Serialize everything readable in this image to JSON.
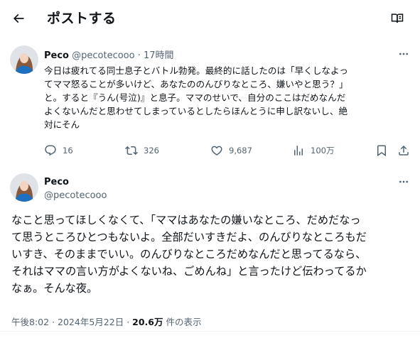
{
  "header": {
    "title": "ポストする",
    "back_icon": "arrow-left-icon",
    "reader_icon": "book-open-icon"
  },
  "parent_post": {
    "name": "Peco",
    "handle": "@pecotecooo",
    "separator": "·",
    "time": "17時間",
    "lines": [
      "今日は疲れてる同士息子とバトル勃発。最終的に話したのは「早くしなよっ",
      "てママ怒ることが多いけど、あなたののんびりなところ、嫌いやと思う？」",
      "と。すると『うん(号泣)』と息子。ママのせいで、自分のここはだめなんだ",
      "よくないんだと思わせてしまっているとしたらほんとうに申し訳ないし、絶",
      "対にそん"
    ],
    "actions": {
      "replies": "16",
      "reposts": "326",
      "likes": "9,687",
      "views": "100万"
    }
  },
  "main_post": {
    "name": "Peco",
    "handle": "@pecotecooo",
    "lines": [
      "なこと思ってほしくなくて、「ママはあなたの嫌いなところ、だめだなっ",
      "て思うところひとつもないよ。全部だいすきだよ、のんびりなところもだ",
      "いすき、そのままでいい。のんびりなところだめなんだと思ってるなら、",
      "それはママの言い方がよくないね、ごめんね」と言ったけど伝わってるか",
      "なぁ。そんな夜。"
    ],
    "time": "午後8:02",
    "separator": "·",
    "date": "2024年5月22日",
    "views_count": "20.6万",
    "views_label": "件の表示"
  },
  "colors": {
    "text": "#0f1419",
    "secondary": "#536471",
    "divider": "#eff3f4"
  }
}
